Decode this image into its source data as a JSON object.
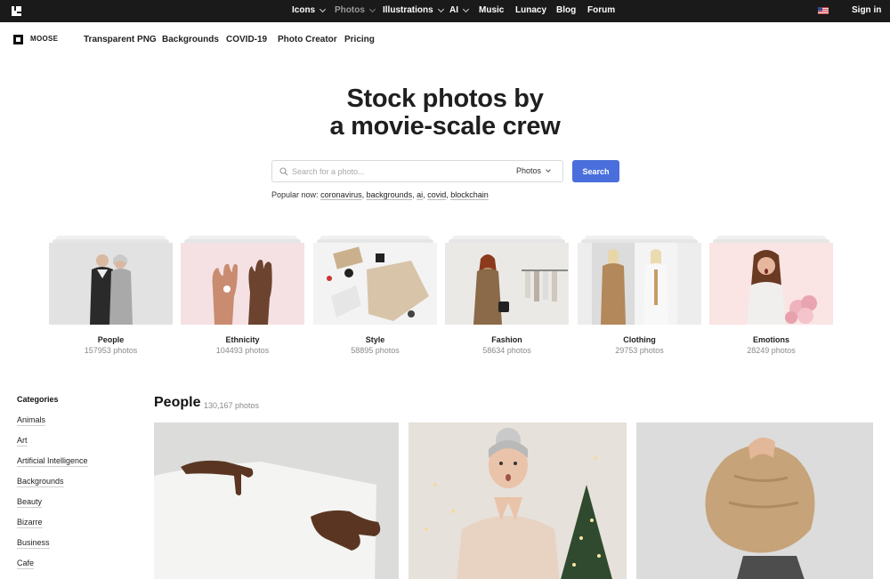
{
  "topbar": {
    "nav": [
      {
        "label": "Icons",
        "dropdown": true,
        "active": false
      },
      {
        "label": "Photos",
        "dropdown": true,
        "active": true
      },
      {
        "label": "Illustrations",
        "dropdown": true,
        "active": false
      },
      {
        "label": "AI",
        "dropdown": true,
        "active": false
      },
      {
        "label": "Music",
        "dropdown": false,
        "active": false
      },
      {
        "label": "Lunacy",
        "dropdown": false,
        "active": false
      },
      {
        "label": "Blog",
        "dropdown": false,
        "active": false
      },
      {
        "label": "Forum",
        "dropdown": false,
        "active": false
      }
    ],
    "sign_in": "Sign in",
    "flag_icon": "us-flag-icon"
  },
  "subnav": {
    "brand": "MOOSE",
    "links": [
      "Transparent PNG",
      "Backgrounds",
      "COVID-19",
      "Photo Creator",
      "Pricing"
    ]
  },
  "hero": {
    "title_line1": "Stock photos by",
    "title_line2": "a movie-scale crew",
    "search_placeholder": "Search for a photo...",
    "search_type": "Photos",
    "search_button": "Search",
    "popular_label": "Popular now:",
    "popular_tags": [
      "coronavirus",
      "backgrounds",
      "ai",
      "covid",
      "blockchain"
    ]
  },
  "categories_cards": [
    {
      "name": "People",
      "count": "157953 photos",
      "bg": "#e4e4e4"
    },
    {
      "name": "Ethnicity",
      "count": "104493 photos",
      "bg": "#f6e3e4"
    },
    {
      "name": "Style",
      "count": "58895 photos",
      "bg": "#f2f2f2"
    },
    {
      "name": "Fashion",
      "count": "58634 photos",
      "bg": "#e9e7e4"
    },
    {
      "name": "Clothing",
      "count": "29753 photos",
      "bg": "#eeeeee"
    },
    {
      "name": "Emotions",
      "count": "28249 photos",
      "bg": "#fae6e6"
    }
  ],
  "sidebar": {
    "heading": "Categories",
    "items": [
      "Animals",
      "Art",
      "Artificial Intelligence",
      "Backgrounds",
      "Beauty",
      "Bizarre",
      "Business",
      "Cafe"
    ]
  },
  "main": {
    "section_title": "People",
    "section_count": "130,167 photos"
  },
  "colors": {
    "topbar_bg": "#1a1a1a",
    "accent": "#4a6fdc"
  }
}
